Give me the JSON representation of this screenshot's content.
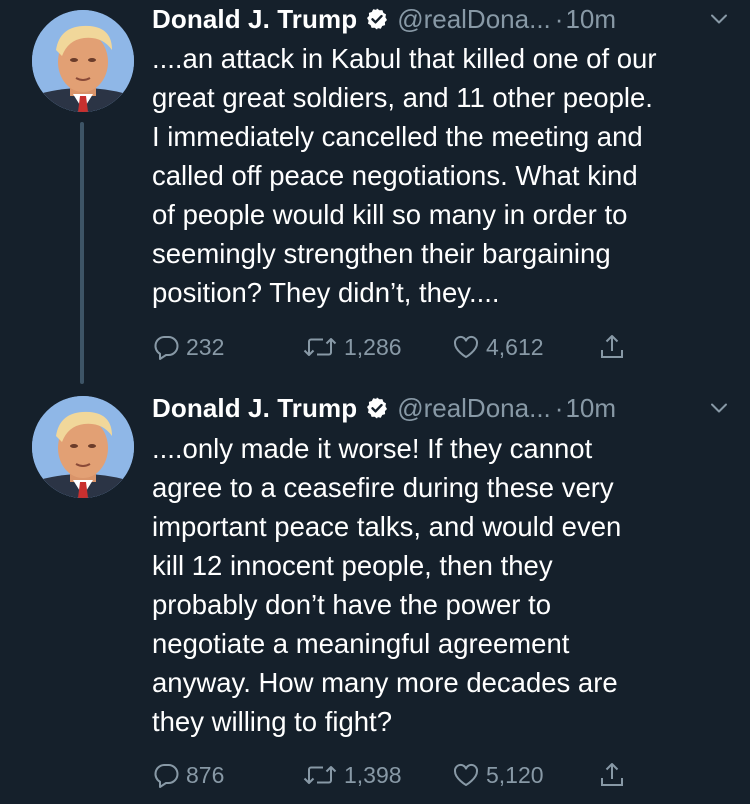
{
  "tweets": [
    {
      "author_name": "Donald J. Trump",
      "handle": "@realDona...",
      "separator": "·",
      "time": "10m",
      "text_lines": [
        "....an attack in Kabul that killed one of our",
        "great great soldiers, and 11 other people.",
        "I immediately cancelled the meeting and",
        "called off peace negotiations. What kind",
        "of people would kill so many in order to",
        "seemingly strengthen their bargaining",
        "position? They didn’t, they...."
      ],
      "replies": "232",
      "retweets": "1,286",
      "likes": "4,612"
    },
    {
      "author_name": "Donald J. Trump",
      "handle": "@realDona...",
      "separator": "·",
      "time": "10m",
      "text_lines": [
        "....only made it worse! If they cannot",
        "agree to a ceasefire during these very",
        "important peace talks, and would even",
        "kill 12 innocent people, then they",
        "probably don’t have the power to",
        "negotiate a meaningful agreement",
        "anyway. How many more decades are",
        "they willing to fight?"
      ],
      "replies": "876",
      "retweets": "1,398",
      "likes": "5,120"
    }
  ],
  "icons": {
    "verified": "verified-badge-icon",
    "more": "chevron-down-icon",
    "reply": "reply-icon",
    "retweet": "retweet-icon",
    "like": "heart-icon",
    "share": "share-icon"
  },
  "colors": {
    "background": "#15202b",
    "text": "#ffffff",
    "secondary": "#8899a6",
    "thread_line": "#3d5466"
  }
}
